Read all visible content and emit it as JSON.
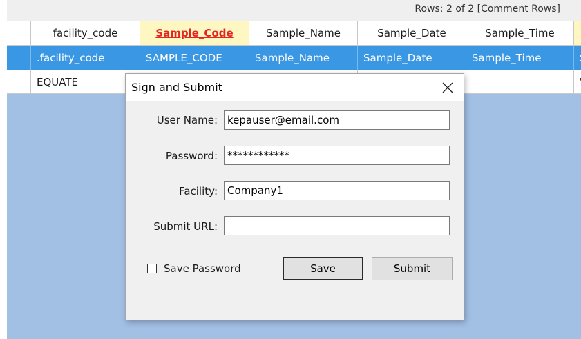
{
  "grid": {
    "rows_info": "Rows: 2 of 2  [Comment Rows]",
    "columns": [
      "facility_code",
      "Sample_Code",
      "Sample_Name",
      "Sample_Date",
      "Sample_Time"
    ],
    "selected_row": [
      ".facility_code",
      "SAMPLE_CODE",
      "Sample_Name",
      "Sample_Date",
      "Sample_Time"
    ],
    "selected_row_partial": "S",
    "data_row": [
      "EQUATE"
    ],
    "data_row_partial": "V",
    "colors": {
      "header_highlight": "#fff7c2",
      "header_highlight_text": "#e3261f",
      "selection": "#3a97e3",
      "empty_area": "#a2bfe4"
    }
  },
  "dialog": {
    "title": "Sign and Submit",
    "close_icon": "close-icon",
    "fields": {
      "user_name": {
        "label": "User Name:",
        "value": "kepauser@email.com"
      },
      "password": {
        "label": "Password:",
        "value": "************"
      },
      "facility": {
        "label": "Facility:",
        "value": "Company1"
      },
      "submit_url": {
        "label": "Submit URL:",
        "value": ""
      }
    },
    "save_password": {
      "label": "Save Password",
      "checked": false
    },
    "buttons": {
      "save": "Save",
      "submit": "Submit"
    }
  }
}
